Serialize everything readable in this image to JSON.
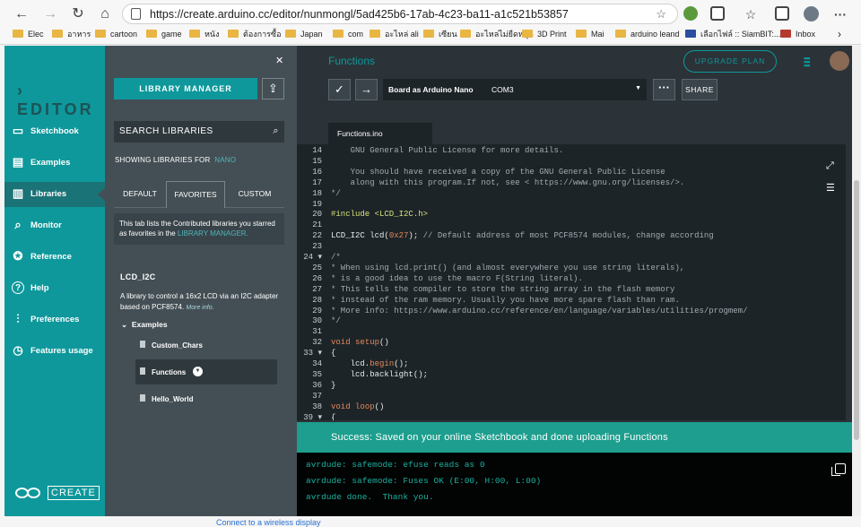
{
  "browser": {
    "url": "https://create.arduino.cc/editor/nunmongl/5ad425b6-17ab-4c23-ba11-a1c521b53857",
    "bookmarks": [
      "Elec",
      "อาหาร",
      "cartoon",
      "game",
      "หนัง",
      "ต้องการซื้อ",
      "Japan",
      "com",
      "อะไหล่ ali",
      "เซียน",
      "อะไหล่ไม่ยืดหยุด",
      "3D Print",
      "Mai",
      "arduino leand",
      "เลือกไฟล์ :: SiamBIT:...",
      "Inbox"
    ]
  },
  "sidebar": {
    "logo": "EDITOR",
    "items": [
      {
        "label": "Sketchbook",
        "icon": "sketchbook-icon"
      },
      {
        "label": "Examples",
        "icon": "examples-icon"
      },
      {
        "label": "Libraries",
        "icon": "libraries-icon",
        "active": true
      },
      {
        "label": "Monitor",
        "icon": "monitor-icon"
      },
      {
        "label": "Reference",
        "icon": "reference-icon"
      },
      {
        "label": "Help",
        "icon": "help-icon"
      },
      {
        "label": "Preferences",
        "icon": "preferences-icon"
      },
      {
        "label": "Features usage",
        "icon": "features-icon"
      }
    ],
    "create_label": "CREATE"
  },
  "library_panel": {
    "manager_label": "LIBRARY MANAGER",
    "search_label": "SEARCH LIBRARIES",
    "showing_prefix": "SHOWING LIBRARIES FOR",
    "showing_board": "NANO",
    "tabs": [
      "DEFAULT",
      "FAVORITES",
      "CUSTOM"
    ],
    "selected_tab": "FAVORITES",
    "fav_info_text": "This tab lists the Contributed libraries you starred as favorites in the",
    "fav_info_link": "LIBRARY MANAGER.",
    "library_name": "LCD_I2C",
    "library_desc": "A library to control a 16x2 LCD via an I2C adapter based on PCF8574.",
    "more_info": "More info.",
    "examples_label": "Examples",
    "examples": [
      "Custom_Chars",
      "Functions",
      "Hello_World"
    ],
    "selected_example": "Functions"
  },
  "editor": {
    "sketch_title": "Functions",
    "upgrade_label": "UPGRADE PLAN",
    "board_label": "Board as Arduino Nano",
    "port": "COM3",
    "share_label": "SHARE",
    "file_tab": "Functions.ino",
    "code_lines": [
      {
        "n": "14",
        "t": "    GNU General Public License for more details.",
        "c": "cm"
      },
      {
        "n": "15",
        "t": "",
        "c": "cm"
      },
      {
        "n": "16",
        "t": "    You should have received a copy of the GNU General Public License",
        "c": "cm"
      },
      {
        "n": "17",
        "t": "    along with this program.If not, see < https://www.gnu.org/licenses/>.",
        "c": "cm"
      },
      {
        "n": "18",
        "t": "*/",
        "c": "cm"
      },
      {
        "n": "19",
        "t": "",
        "c": ""
      },
      {
        "n": "20",
        "t": "#include <LCD_I2C.h>",
        "c": "pp"
      },
      {
        "n": "21",
        "t": "",
        "c": ""
      },
      {
        "n": "22",
        "t": "LCD_I2C lcd(0x27); // Default address of most PCF8574 modules, change according",
        "c": "mix1"
      },
      {
        "n": "23",
        "t": "",
        "c": ""
      },
      {
        "n": "24 ▾",
        "t": "/*",
        "c": "cm"
      },
      {
        "n": "25",
        "t": "* When using lcd.print() (and almost everywhere you use string literals),",
        "c": "cm"
      },
      {
        "n": "26",
        "t": "* is a good idea to use the macro F(String literal).",
        "c": "cm"
      },
      {
        "n": "27",
        "t": "* This tells the compiler to store the string array in the flash memory",
        "c": "cm"
      },
      {
        "n": "28",
        "t": "* instead of the ram memory. Usually you have more spare flash than ram.",
        "c": "cm"
      },
      {
        "n": "29",
        "t": "* More info: https://www.arduino.cc/reference/en/language/variables/utilities/progmem/",
        "c": "cm"
      },
      {
        "n": "30",
        "t": "*/",
        "c": "cm"
      },
      {
        "n": "31",
        "t": "",
        "c": ""
      },
      {
        "n": "32",
        "t": "void setup()",
        "c": "mix2"
      },
      {
        "n": "33 ▾",
        "t": "{",
        "c": ""
      },
      {
        "n": "34",
        "t": "    lcd.begin();",
        "c": "mix3"
      },
      {
        "n": "35",
        "t": "    lcd.backlight();",
        "c": ""
      },
      {
        "n": "36",
        "t": "}",
        "c": ""
      },
      {
        "n": "37",
        "t": "",
        "c": ""
      },
      {
        "n": "38",
        "t": "void loop()",
        "c": "mix4"
      },
      {
        "n": "39 ▾",
        "t": "{",
        "c": ""
      }
    ],
    "success_message": "Success: Saved on your online Sketchbook and done uploading Functions",
    "console_lines": [
      "avrdude: safemode: efuse reads as 0",
      "avrdude: safemode: Fuses OK (E:00, H:00, L:00)",
      "avrdude done.  Thank you."
    ]
  },
  "below_text": "Connect to a wireless display",
  "colors": {
    "teal": "#0e989b",
    "panel": "#444f55",
    "editor_bg": "#1d2428",
    "success": "#1d9e8e",
    "console_text": "#1bb09d"
  }
}
